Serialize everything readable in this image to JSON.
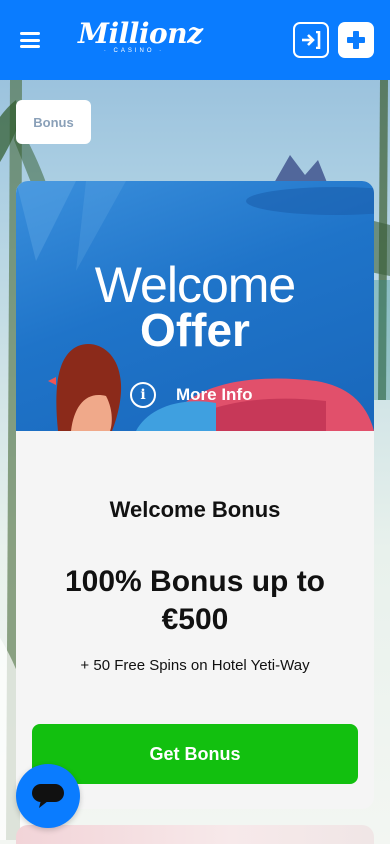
{
  "header": {
    "logo_text": "Millionz",
    "logo_sub": "· CASINO ·",
    "menu_icon": "hamburger-icon",
    "login_icon": "login-arrow-icon",
    "register_icon": "plus-icon"
  },
  "tag": {
    "label": "Bonus"
  },
  "promo": {
    "welcome": "Welcome",
    "offer": "Offer",
    "more_info": "More Info",
    "info_icon_glyph": "i"
  },
  "bonus": {
    "title": "Welcome Bonus",
    "amount": "100% Bonus up to €500",
    "extra": "+ 50 Free Spins on Hotel Yeti-Way",
    "cta": "Get Bonus"
  },
  "colors": {
    "brand_blue": "#0a7cff",
    "cta_green": "#12c00f",
    "tag_text": "#8aa0b8"
  },
  "chat": {
    "icon": "chat-bubble-icon"
  }
}
